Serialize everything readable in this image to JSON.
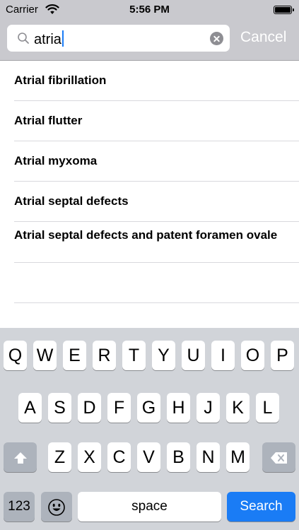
{
  "status": {
    "carrier": "Carrier",
    "time": "5:56 PM"
  },
  "search": {
    "query": "atria",
    "cancel_label": "Cancel"
  },
  "results": [
    "Atrial fibrillation",
    "Atrial flutter",
    "Atrial myxoma",
    "Atrial septal defects",
    "Atrial septal defects and patent foramen ovale"
  ],
  "keyboard": {
    "row1": [
      "Q",
      "W",
      "E",
      "R",
      "T",
      "Y",
      "U",
      "I",
      "O",
      "P"
    ],
    "row2": [
      "A",
      "S",
      "D",
      "F",
      "G",
      "H",
      "J",
      "K",
      "L"
    ],
    "row3": [
      "Z",
      "X",
      "C",
      "V",
      "B",
      "N",
      "M"
    ],
    "numbers_label": "123",
    "space_label": "space",
    "search_label": "Search",
    "shift_icon": "shift-arrow-icon",
    "delete_icon": "backspace-icon",
    "emoji_icon": "smiley-icon"
  },
  "colors": {
    "accent": "#1a7cf5",
    "keyboard_bg": "#d1d4d9",
    "header_bg": "#c9c9ce"
  }
}
